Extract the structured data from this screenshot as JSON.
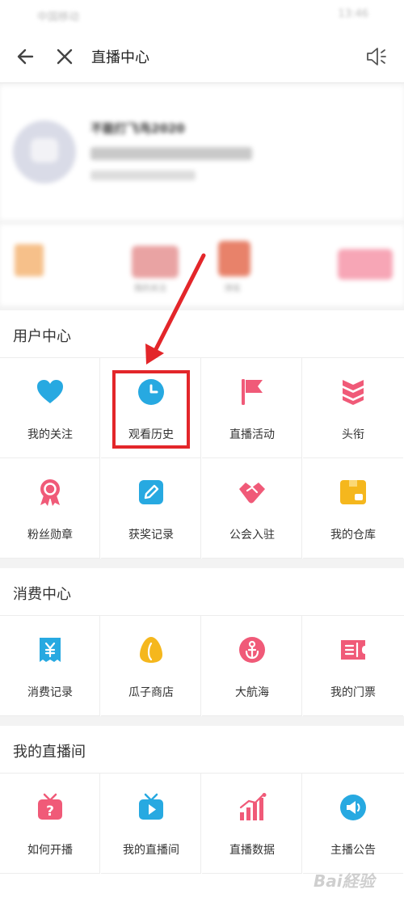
{
  "statusbar": {
    "carrier": "中国移动",
    "time": "13:46"
  },
  "nav": {
    "title": "直播中心"
  },
  "profile": {
    "name": "不能打飞鸟2020"
  },
  "banner": {
    "label_left": "我的关注",
    "label_mid": "排名"
  },
  "sections": {
    "user": {
      "title": "用户中心",
      "items": [
        {
          "label": "我的关注",
          "icon": "heart-icon"
        },
        {
          "label": "观看历史",
          "icon": "clock-icon"
        },
        {
          "label": "直播活动",
          "icon": "flag-icon"
        },
        {
          "label": "头衔",
          "icon": "rank-chevron-icon"
        },
        {
          "label": "粉丝勋章",
          "icon": "medal-icon"
        },
        {
          "label": "获奖记录",
          "icon": "edit-icon"
        },
        {
          "label": "公会入驻",
          "icon": "handshake-icon"
        },
        {
          "label": "我的仓库",
          "icon": "box-icon"
        }
      ]
    },
    "consume": {
      "title": "消费中心",
      "items": [
        {
          "label": "消费记录",
          "icon": "yuan-receipt-icon"
        },
        {
          "label": "瓜子商店",
          "icon": "seed-icon"
        },
        {
          "label": "大航海",
          "icon": "anchor-icon"
        },
        {
          "label": "我的门票",
          "icon": "ticket-icon"
        }
      ]
    },
    "live": {
      "title": "我的直播间",
      "items": [
        {
          "label": "如何开播",
          "icon": "tv-question-icon"
        },
        {
          "label": "我的直播间",
          "icon": "tv-play-icon"
        },
        {
          "label": "直播数据",
          "icon": "bar-chart-icon"
        },
        {
          "label": "主播公告",
          "icon": "megaphone-icon"
        }
      ]
    }
  },
  "watermark": "Bai経验",
  "colors": {
    "pink": "#f05a78",
    "blue": "#27a9e1",
    "yellow": "#f5b71d",
    "red_mark": "#e3262a"
  }
}
